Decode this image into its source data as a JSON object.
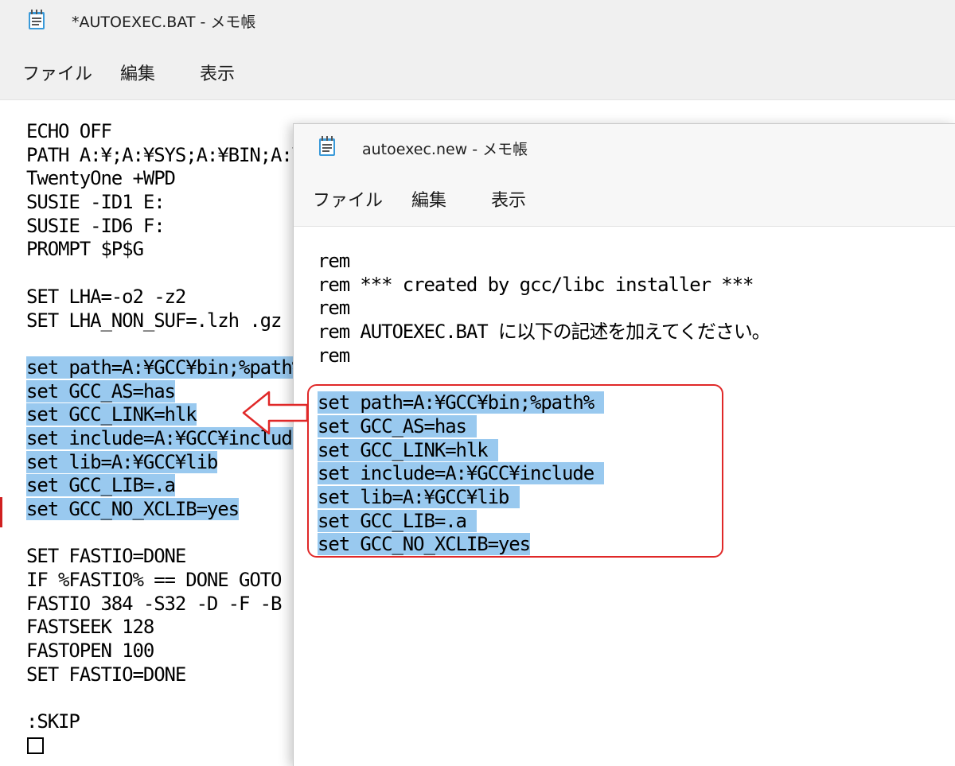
{
  "back_window": {
    "title": "*AUTOEXEC.BAT - メモ帳",
    "menu": {
      "file": "ファイル",
      "edit": "編集",
      "view": "表示"
    },
    "lines": [
      {
        "text": "ECHO OFF",
        "selected": false
      },
      {
        "text": "PATH A:¥;A:¥SYS;A:¥BIN;A:¥ETC",
        "selected": false
      },
      {
        "text": "TwentyOne +WPD",
        "selected": false
      },
      {
        "text": "SUSIE -ID1 E:",
        "selected": false
      },
      {
        "text": "SUSIE -ID6 F:",
        "selected": false
      },
      {
        "text": "PROMPT $P$G",
        "selected": false
      },
      {
        "text": "",
        "selected": false
      },
      {
        "text": "SET LHA=-o2 -z2",
        "selected": false
      },
      {
        "text": "SET LHA_NON_SUF=.lzh .gz",
        "selected": false
      },
      {
        "text": "",
        "selected": false
      },
      {
        "text": "set path=A:¥GCC¥bin;%path%",
        "selected": true
      },
      {
        "text": "set GCC_AS=has",
        "selected": true
      },
      {
        "text": "set GCC_LINK=hlk",
        "selected": true
      },
      {
        "text": "set include=A:¥GCC¥include",
        "selected": true
      },
      {
        "text": "set lib=A:¥GCC¥lib",
        "selected": true
      },
      {
        "text": "set GCC_LIB=.a",
        "selected": true
      },
      {
        "text": "set GCC_NO_XCLIB=yes",
        "selected": true
      },
      {
        "text": "",
        "selected": false
      },
      {
        "text": "SET FASTIO=DONE",
        "selected": false
      },
      {
        "text": "IF %FASTIO% == DONE GOTO SKIP",
        "selected": false
      },
      {
        "text": "FASTIO 384 -S32 -D -F -B",
        "selected": false
      },
      {
        "text": "FASTSEEK 128",
        "selected": false
      },
      {
        "text": "FASTOPEN 100",
        "selected": false
      },
      {
        "text": "SET FASTIO=DONE",
        "selected": false
      },
      {
        "text": "",
        "selected": false
      },
      {
        "text": ":SKIP",
        "selected": false
      }
    ]
  },
  "front_window": {
    "title": "autoexec.new - メモ帳",
    "menu": {
      "file": "ファイル",
      "edit": "編集",
      "view": "表示"
    },
    "lines": [
      {
        "text": "rem",
        "selected": false
      },
      {
        "text": "rem *** created by gcc/libc installer ***",
        "selected": false
      },
      {
        "text": "rem",
        "selected": false
      },
      {
        "text": "rem AUTOEXEC.BAT に以下の記述を加えてください。",
        "selected": false
      },
      {
        "text": "rem",
        "selected": false
      },
      {
        "text": "",
        "selected": false
      },
      {
        "text": "set path=A:¥GCC¥bin;%path% ",
        "selected": true
      },
      {
        "text": "set GCC_AS=has ",
        "selected": true
      },
      {
        "text": "set GCC_LINK=hlk ",
        "selected": true
      },
      {
        "text": "set include=A:¥GCC¥include ",
        "selected": true
      },
      {
        "text": "set lib=A:¥GCC¥lib ",
        "selected": true
      },
      {
        "text": "set GCC_LIB=.a ",
        "selected": true
      },
      {
        "text": "set GCC_NO_XCLIB=yes",
        "selected": true
      }
    ]
  },
  "colors": {
    "selection": "#99c9ef",
    "annotation": "#e02828"
  },
  "icons": {
    "app": "notepad-icon",
    "end_of_file": "eof-box-icon",
    "annotation_arrow": "left-arrow-icon"
  }
}
